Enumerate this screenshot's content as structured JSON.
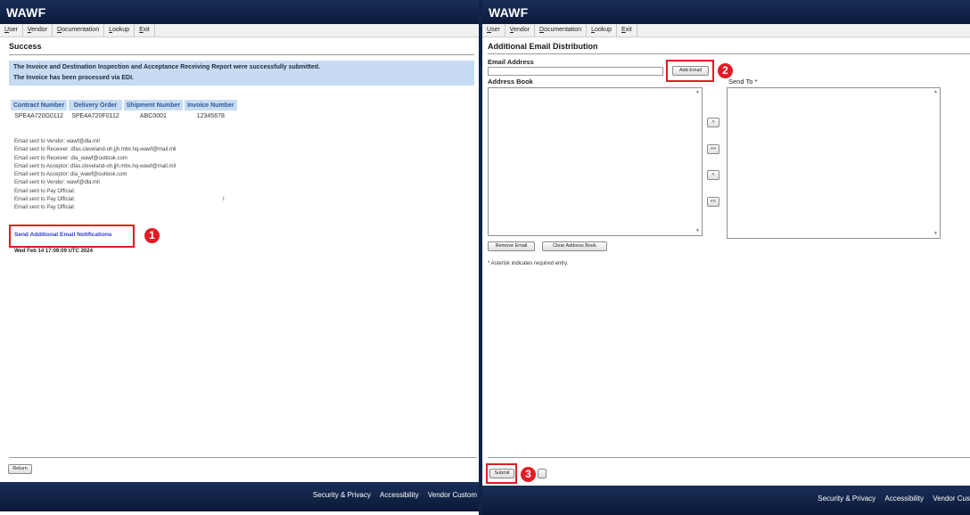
{
  "left": {
    "brand": "WAWF",
    "menu": [
      "User",
      "Vendor",
      "Documentation",
      "Lookup",
      "Exit"
    ],
    "title": "Success",
    "messages": [
      "The Invoice and Destination Inspection and Acceptance Receiving Report were successfully submitted.",
      "The Invoice has been processed via EDI."
    ],
    "summary_headers": [
      "Contract Number",
      "Delivery Order",
      "Shipment Number",
      "Invoice Number"
    ],
    "summary_values": [
      "SPE4A720G0112",
      "SPE4A720F0112",
      "ABC0001",
      "12345678"
    ],
    "emails": [
      "Email sent to Vendor: wawf@dla.mil",
      "Email sent to Receiver: dfas.cleveland-oh.jjh.mbx.hq-wawf@mail.mil",
      "Email sent to Receiver: dla_wawf@outlook.com",
      "Email sent to Acceptor: dfas.cleveland-oh.jjh.mbx.hq-wawf@mail.mil",
      "Email sent to Acceptor: dla_wawf@outlook.com",
      "Email sent to Vendor: wawf@dla.mil",
      "Email sent to Pay Official:",
      "Email sent to Pay Official:",
      "Email sent to Pay Official:"
    ],
    "tick_mark": "I",
    "link": "Send Additional Email Notifications",
    "timestamp": "Wed Feb 14 17:09:09 UTC 2024",
    "return_button": "Return",
    "footer": [
      "Security & Privacy",
      "Accessibility",
      "Vendor Custom"
    ]
  },
  "right": {
    "brand": "WAWF",
    "menu": [
      "User",
      "Vendor",
      "Documentation",
      "Lookup",
      "Exit"
    ],
    "title": "Additional Email Distribution",
    "email_label": "Email Address",
    "email_value": "",
    "add_button": "Add Email",
    "address_book_label": "Address Book",
    "send_to_label": "Send To *",
    "move_buttons": [
      ">",
      ">>",
      "<",
      "<<"
    ],
    "remove_button": "Remove Email",
    "clear_button": "Clear Address Book",
    "note": "* Asterisk indicates required entry.",
    "submit_button": "Submit",
    "footer": [
      "Security & Privacy",
      "Accessibility",
      "Vendor Cus"
    ]
  },
  "annotations": [
    "1",
    "2",
    "3"
  ],
  "colors": {
    "header_bg": "#0c1a3c",
    "success_bg": "#c7dcf3",
    "link": "#2b3bd6",
    "highlight": "#e31b23"
  }
}
